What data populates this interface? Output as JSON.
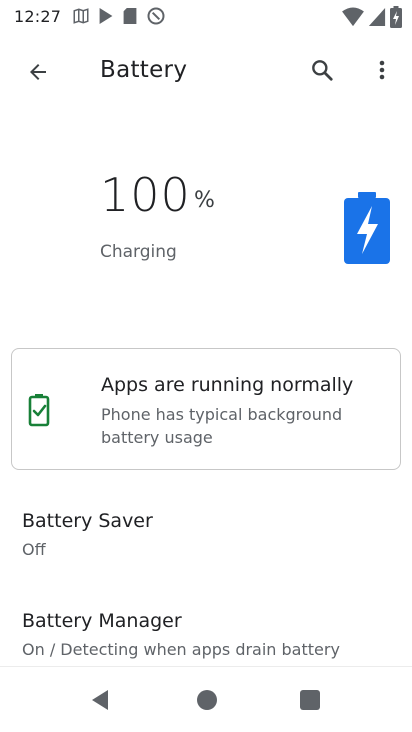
{
  "status_bar": {
    "time": "12:27",
    "left_icons": [
      "maps-icon",
      "play-store-icon",
      "sd-card-icon",
      "data-saver-icon"
    ],
    "right_icons": [
      "wifi-icon",
      "cell-signal-icon",
      "battery-charging-icon"
    ]
  },
  "app_bar": {
    "title": "Battery",
    "back_icon": "arrow-back-icon",
    "search_icon": "search-icon",
    "more_icon": "more-vert-icon"
  },
  "battery_header": {
    "level": "100",
    "unit": "%",
    "status": "Charging",
    "fill_fraction": 1.0,
    "accent_color": "#1a73e8"
  },
  "tip_card": {
    "title": "Apps are running normally",
    "summary": "Phone has typical background battery usage",
    "icon": "battery-check-icon",
    "icon_color": "#188038"
  },
  "preferences": [
    {
      "title": "Battery Saver",
      "summary": "Off"
    },
    {
      "title": "Battery Manager",
      "summary": "On / Detecting when apps drain battery"
    }
  ],
  "nav_bar": {
    "icons": [
      "nav-back-icon",
      "nav-home-icon",
      "nav-recents-icon"
    ]
  }
}
